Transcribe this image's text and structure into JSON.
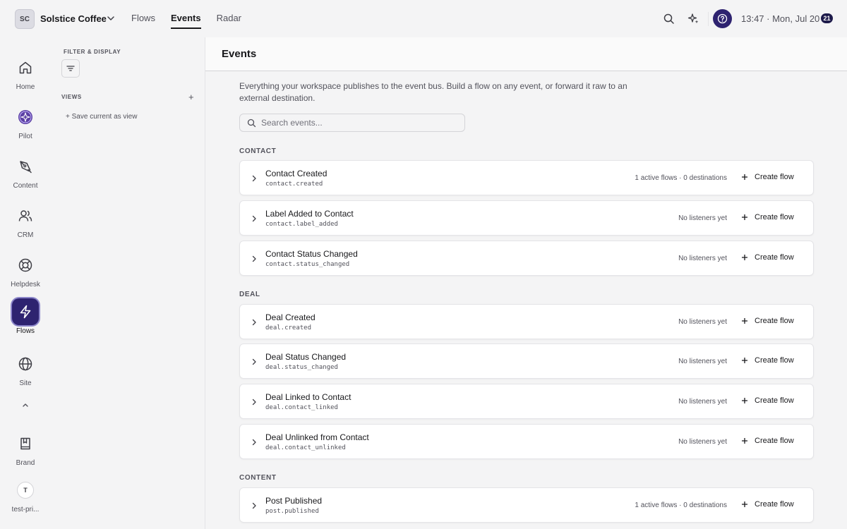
{
  "workspace": {
    "initials": "SC",
    "name": "Solstice Coffee"
  },
  "topnav": [
    {
      "label": "Flows"
    },
    {
      "label": "Events"
    },
    {
      "label": "Radar"
    }
  ],
  "topbar": {
    "time": "13:47 · Mon, Jul 20",
    "badge": "21"
  },
  "rail": {
    "items": [
      {
        "label": "Home",
        "icon": "home-icon"
      },
      {
        "label": "Pilot",
        "icon": "pilot-icon"
      },
      {
        "label": "Content",
        "icon": "pen-icon"
      },
      {
        "label": "CRM",
        "icon": "users-icon"
      },
      {
        "label": "Helpdesk",
        "icon": "lifebuoy-icon"
      },
      {
        "label": "Flows",
        "icon": "lightning-icon"
      },
      {
        "label": "Site",
        "icon": "globe-icon"
      },
      {
        "label": "Brand",
        "icon": "book-icon"
      }
    ],
    "user": {
      "initial": "T",
      "label": "test-pri..."
    }
  },
  "panel": {
    "filter_title": "FILTER & DISPLAY",
    "views_title": "VIEWS",
    "save_view": "+ Save current as view"
  },
  "main": {
    "title": "Events",
    "description": "Everything your workspace publishes to the event bus. Build a flow on any event, or forward it raw to an external destination.",
    "search_placeholder": "Search events..."
  },
  "create_label": "Create flow",
  "sections": [
    {
      "label": "CONTACT",
      "events": [
        {
          "name": "Contact Created",
          "code": "contact.created",
          "status": "1 active flows · 0 destinations"
        },
        {
          "name": "Label Added to Contact",
          "code": "contact.label_added",
          "status": "No listeners yet"
        },
        {
          "name": "Contact Status Changed",
          "code": "contact.status_changed",
          "status": "No listeners yet"
        }
      ]
    },
    {
      "label": "DEAL",
      "events": [
        {
          "name": "Deal Created",
          "code": "deal.created",
          "status": "No listeners yet"
        },
        {
          "name": "Deal Status Changed",
          "code": "deal.status_changed",
          "status": "No listeners yet"
        },
        {
          "name": "Deal Linked to Contact",
          "code": "deal.contact_linked",
          "status": "No listeners yet"
        },
        {
          "name": "Deal Unlinked from Contact",
          "code": "deal.contact_unlinked",
          "status": "No listeners yet"
        }
      ]
    },
    {
      "label": "CONTENT",
      "events": [
        {
          "name": "Post Published",
          "code": "post.published",
          "status": "1 active flows · 0 destinations"
        }
      ]
    }
  ]
}
